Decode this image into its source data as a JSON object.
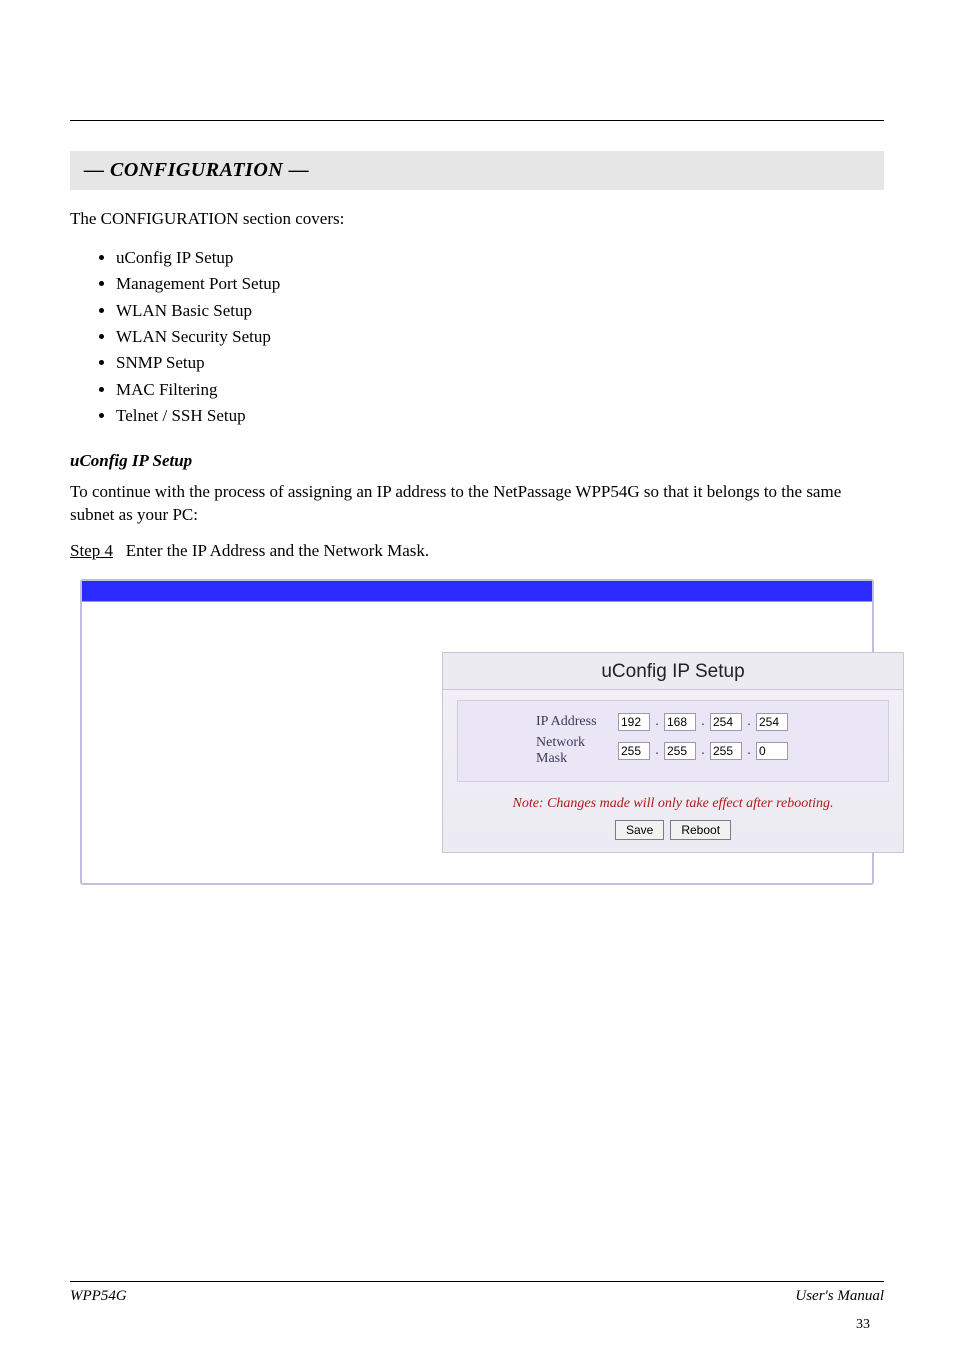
{
  "section": {
    "title": "— CONFIGURATION —",
    "intro": "The CONFIGURATION section covers:",
    "items": [
      "uConfig IP Setup",
      "Management Port Setup",
      "WLAN Basic Setup",
      "WLAN Security Setup",
      "SNMP Setup",
      "MAC Filtering",
      "Telnet / SSH Setup"
    ]
  },
  "uconfig": {
    "sub_title": "uConfig IP Setup",
    "desc": "To continue with the process of assigning an IP address to the NetPassage WPP54G so that it belongs to the same subnet as your PC:",
    "step4_num": "Step 4",
    "step4_text": "Enter the IP Address and the Network Mask.",
    "panel_title": "uConfig IP Setup",
    "ip_label": "IP Address",
    "mask_label": "Network Mask",
    "ip": [
      "192",
      "168",
      "254",
      "254"
    ],
    "mask": [
      "255",
      "255",
      "255",
      "0"
    ],
    "note": "Note: Changes made will only take effect after rebooting.",
    "save_label": "Save",
    "reboot_label": "Reboot"
  },
  "footer": {
    "left": "WPP54G",
    "right": "User's Manual",
    "page_num": "33"
  }
}
